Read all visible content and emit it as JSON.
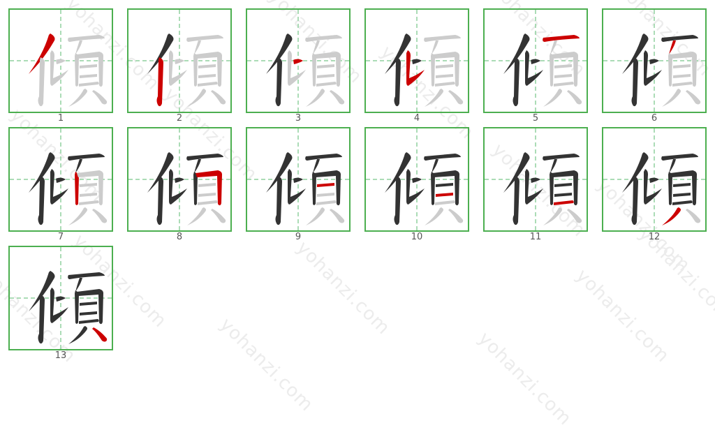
{
  "character": "傾",
  "watermark": "yohanzi.com",
  "colors": {
    "border": "#4caf50",
    "guide": "#8fd19e",
    "done_stroke": "#333333",
    "current_stroke": "#cc0000",
    "pending_stroke": "#cccccc",
    "label": "#555555"
  },
  "total_strokes": 13,
  "steps": [
    {
      "label": "1",
      "stroke": 1
    },
    {
      "label": "2",
      "stroke": 2
    },
    {
      "label": "3",
      "stroke": 3
    },
    {
      "label": "4",
      "stroke": 4
    },
    {
      "label": "5",
      "stroke": 5
    },
    {
      "label": "6",
      "stroke": 6
    },
    {
      "label": "7",
      "stroke": 7
    },
    {
      "label": "8",
      "stroke": 8
    },
    {
      "label": "9",
      "stroke": 9
    },
    {
      "label": "10",
      "stroke": 10
    },
    {
      "label": "11",
      "stroke": 11
    },
    {
      "label": "12",
      "stroke": 12
    },
    {
      "label": "13",
      "stroke": 13
    }
  ]
}
